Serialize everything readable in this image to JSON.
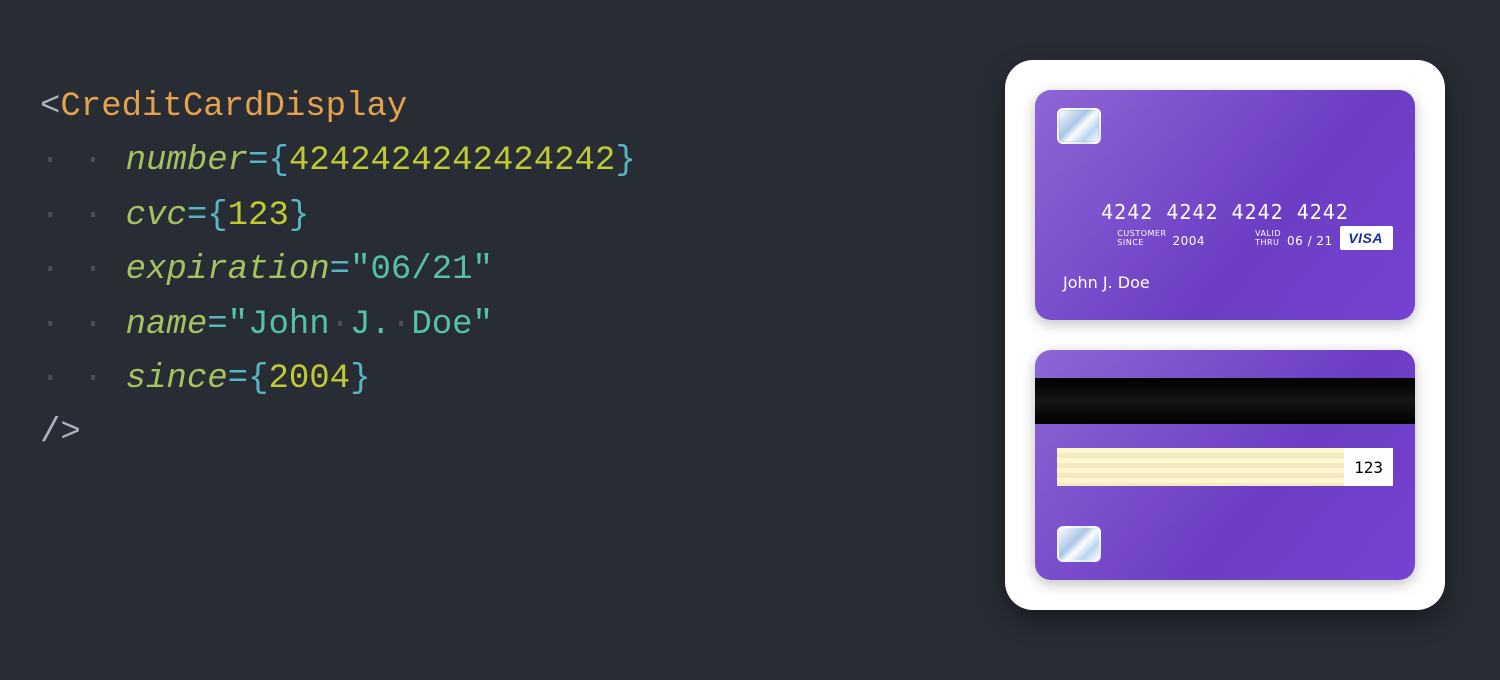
{
  "code": {
    "component": "CreditCardDisplay",
    "props": {
      "number": {
        "name": "number",
        "kind": "expr",
        "value": "4242424242424242"
      },
      "cvc": {
        "name": "cvc",
        "kind": "expr",
        "value": "123"
      },
      "expiration": {
        "name": "expiration",
        "kind": "string",
        "value": "06/21"
      },
      "name": {
        "name": "name",
        "kind": "string",
        "value": "John J. Doe"
      },
      "since": {
        "name": "since",
        "kind": "expr",
        "value": "2004"
      }
    }
  },
  "card": {
    "number_display": "4242 4242 4242 4242",
    "since_label": "CUSTOMER\nSINCE",
    "since_value": "2004",
    "valid_label": "VALID\nTHRU",
    "valid_value": "06 / 21",
    "name": "John J. Doe",
    "brand": "VISA",
    "cvc": "123"
  }
}
